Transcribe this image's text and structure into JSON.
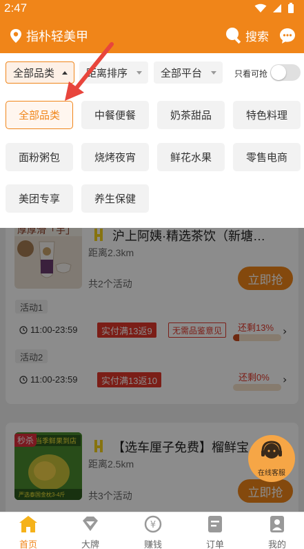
{
  "status": {
    "time": "2:47"
  },
  "header": {
    "location": "指朴轻美甲",
    "search_label": "搜索"
  },
  "filters": {
    "category": "全部品类",
    "sort": "距离排序",
    "platform": "全部平台",
    "grab_only": "只看可抢",
    "grab_only_on": false
  },
  "categories": [
    "全部品类",
    "中餐便餐",
    "奶茶甜品",
    "特色料理",
    "面粉粥包",
    "烧烤夜宵",
    "鲜花水果",
    "零售电商",
    "美团专享",
    "养生保健"
  ],
  "stores": [
    {
      "name": "沪上阿姨·精选茶饮（新塘…",
      "distance": "距离2.3km",
      "activity_count": "共2个活动",
      "button": "立即抢",
      "thumb_text": "厚厚滑「芋」",
      "activities": [
        {
          "label": "活动1",
          "time": "11:00-23:59",
          "promo": "实付满13返9",
          "note": "无需品鉴意见",
          "remaining": "还剩13%",
          "progress": 0.13
        },
        {
          "label": "活动2",
          "time": "11:00-23:59",
          "promo": "实付满13返10",
          "note": "",
          "remaining": "还剩0%",
          "progress": 0
        }
      ]
    },
    {
      "name": "【选车厘子免费】榴鲜宝…",
      "distance": "距离2.5km",
      "activity_count": "共3个活动",
      "button": "立即抢",
      "thumb_badge": "秒杀",
      "thumb_text": "当季鲜果到店",
      "thumb_caption": "严选泰国金枕3-4斤"
    }
  ],
  "service": {
    "label": "在线客服"
  },
  "tabs": [
    {
      "label": "首页",
      "icon": "home-icon",
      "active": true
    },
    {
      "label": "大牌",
      "icon": "diamond-icon",
      "active": false
    },
    {
      "label": "赚钱",
      "icon": "yen-icon",
      "active": false
    },
    {
      "label": "订单",
      "icon": "order-icon",
      "active": false
    },
    {
      "label": "我的",
      "icon": "profile-icon",
      "active": false
    }
  ],
  "colors": {
    "brand": "#f08519",
    "promo_red": "#e0382a"
  }
}
